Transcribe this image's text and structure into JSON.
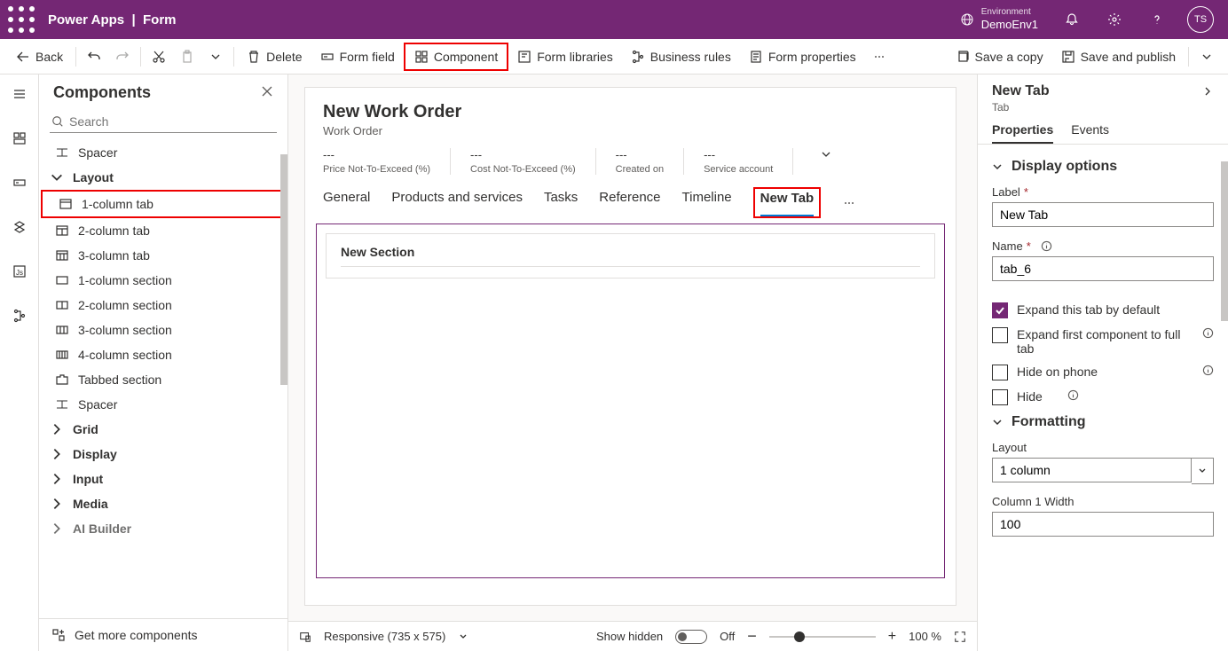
{
  "header": {
    "app": "Power Apps",
    "page": "Form",
    "env_label": "Environment",
    "env_name": "DemoEnv1",
    "avatar": "TS"
  },
  "toolbar": {
    "back": "Back",
    "delete": "Delete",
    "form_field": "Form field",
    "component": "Component",
    "form_libraries": "Form libraries",
    "business_rules": "Business rules",
    "form_properties": "Form properties",
    "save_copy": "Save a copy",
    "save_publish": "Save and publish"
  },
  "sidebar": {
    "title": "Components",
    "search_ph": "Search",
    "items": {
      "spacer": "Spacer",
      "layout": "Layout",
      "col1tab": "1-column tab",
      "col2tab": "2-column tab",
      "col3tab": "3-column tab",
      "col1sec": "1-column section",
      "col2sec": "2-column section",
      "col3sec": "3-column section",
      "col4sec": "4-column section",
      "tabbedsec": "Tabbed section",
      "spacer2": "Spacer",
      "grid": "Grid",
      "display": "Display",
      "input": "Input",
      "media": "Media",
      "ai": "AI Builder"
    },
    "footer": "Get more components"
  },
  "form": {
    "title": "New Work Order",
    "entity": "Work Order",
    "kpis": [
      {
        "val": "---",
        "lbl": "Price Not-To-Exceed (%)"
      },
      {
        "val": "---",
        "lbl": "Cost Not-To-Exceed (%)"
      },
      {
        "val": "---",
        "lbl": "Created on"
      },
      {
        "val": "---",
        "lbl": "Service account"
      }
    ],
    "tabs": [
      "General",
      "Products and services",
      "Tasks",
      "Reference",
      "Timeline",
      "New Tab"
    ],
    "section": "New Section"
  },
  "status": {
    "responsive": "Responsive (735 x 575)",
    "show_hidden": "Show hidden",
    "off": "Off",
    "zoom": "100 %"
  },
  "rp": {
    "title": "New Tab",
    "subtitle": "Tab",
    "tabs": {
      "properties": "Properties",
      "events": "Events"
    },
    "display_options": "Display options",
    "label_lbl": "Label",
    "label_val": "New Tab",
    "name_lbl": "Name",
    "name_val": "tab_6",
    "expand_default": "Expand this tab by default",
    "expand_first": "Expand first component to full tab",
    "hide_phone": "Hide on phone",
    "hide": "Hide",
    "formatting": "Formatting",
    "layout_lbl": "Layout",
    "layout_val": "1 column",
    "col1w_lbl": "Column 1 Width",
    "col1w_val": "100"
  }
}
